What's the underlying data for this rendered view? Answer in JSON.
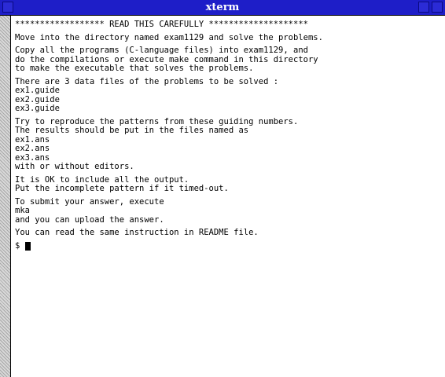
{
  "window": {
    "title": "xterm"
  },
  "terminal": {
    "banner": "****************** READ THIS CAREFULLY ********************",
    "paragraphs": [
      [
        "Move into the directory named exam1129 and solve the problems."
      ],
      [
        "Copy all the programs (C-language files) into exam1129, and",
        "do the compilations or execute make command in this directory",
        "to make the executable that solves the problems."
      ],
      [
        "There are 3 data files of the problems to be solved :",
        "ex1.guide",
        "ex2.guide",
        "ex3.guide"
      ],
      [
        "Try to reproduce the patterns from these guiding numbers.",
        "The results should be put in the files named as",
        "ex1.ans",
        "ex2.ans",
        "ex3.ans",
        "with or without editors."
      ],
      [
        "It is OK to include all the output.",
        "Put the incomplete pattern if it timed-out."
      ],
      [
        "To submit your answer, execute",
        "mka",
        "and you can upload the answer."
      ],
      [
        "You can read the same instruction in README file."
      ]
    ],
    "prompt": "$ "
  }
}
